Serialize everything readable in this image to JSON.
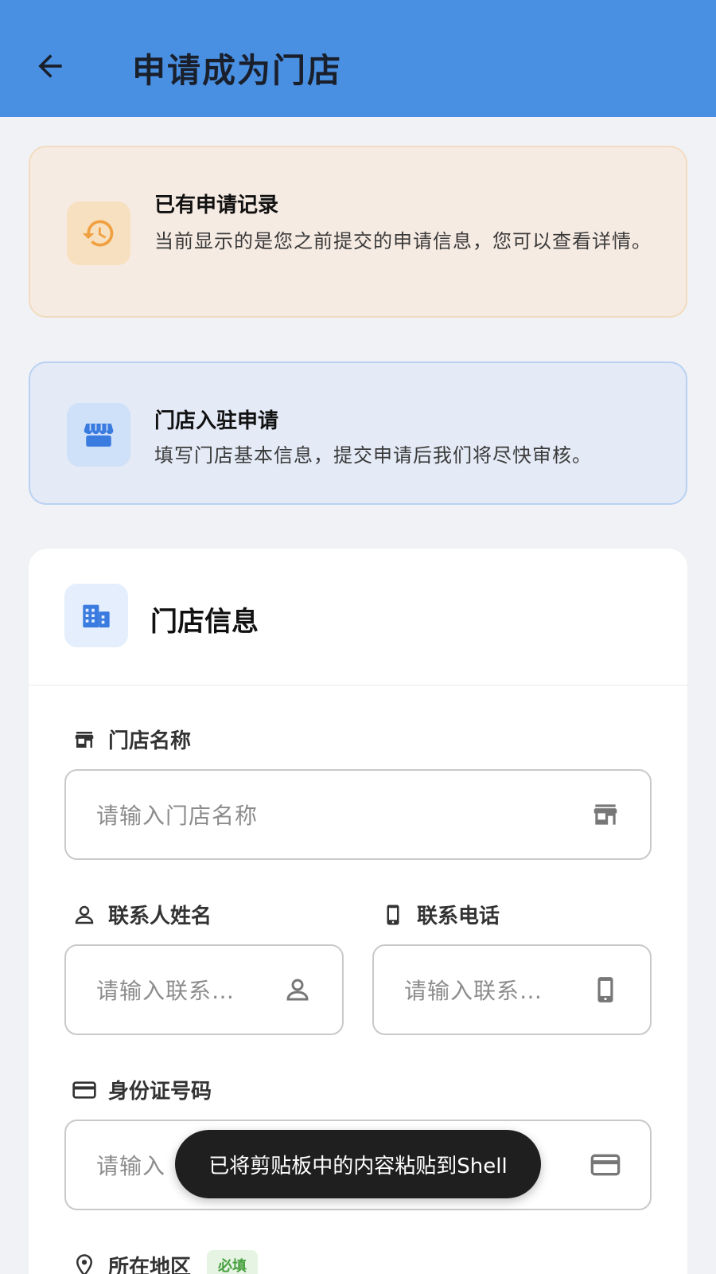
{
  "appbar": {
    "title": "申请成为门店",
    "back_icon": "arrow-left-icon"
  },
  "history_notice": {
    "icon": "history-icon",
    "title": "已有申请记录",
    "description": "当前显示的是您之前提交的申请信息，您可以查看详情。"
  },
  "store_notice": {
    "icon": "storefront-icon",
    "title": "门店入驻申请",
    "description": "填写门店基本信息，提交申请后我们将尽快审核。"
  },
  "form": {
    "section_icon": "building-icon",
    "section_title": "门店信息",
    "fields": {
      "store_name": {
        "label": "门店名称",
        "placeholder": "请输入门店名称",
        "icon": "store-icon"
      },
      "contact_name": {
        "label": "联系人姓名",
        "placeholder": "请输入联系…",
        "icon": "person-icon"
      },
      "contact_phone": {
        "label": "联系电话",
        "placeholder": "请输入联系…",
        "icon": "phone-icon"
      },
      "id_number": {
        "label": "身份证号码",
        "placeholder": "请输入",
        "icon": "id-card-icon"
      },
      "region": {
        "label": "所在地区",
        "badge": "必填",
        "icon": "location-pin-icon"
      }
    }
  },
  "toast": {
    "message": "已将剪贴板中的内容粘贴到Shell"
  },
  "colors": {
    "appbar": "#4a90e2",
    "history_bg": "#f6ebe3",
    "history_accent": "#f0a040",
    "store_bg": "#e4eaf6",
    "store_accent": "#3a7be0",
    "required_badge": "#49a040"
  }
}
